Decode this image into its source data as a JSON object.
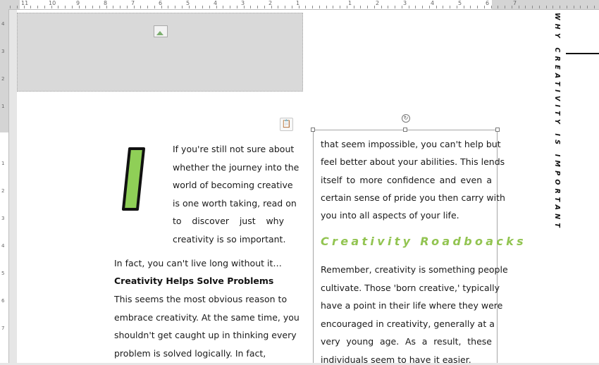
{
  "ruler_top": {
    "labels": [
      "11",
      "10",
      "9",
      "8",
      "7",
      "6",
      "5",
      "4",
      "3",
      "2",
      "1",
      "1",
      "2",
      "3",
      "4",
      "5",
      "6",
      "7"
    ]
  },
  "ruler_left": {
    "labels": [
      "4",
      "3",
      "2",
      "1",
      "1",
      "2",
      "3",
      "4",
      "5",
      "6",
      "7"
    ]
  },
  "colors": {
    "accent_green": "#92c451",
    "drop_cap_fill": "#8fcf57"
  },
  "document": {
    "drop_cap_letter": "I",
    "intro_lines": [
      "If you're still not sure about",
      "whether the journey into the",
      "world of becoming creative",
      "is one worth taking, read on",
      "to discover just why",
      "creativity is so important."
    ],
    "fact_line": "In fact, you can't live long without it…",
    "section_heading": "Creativity Helps Solve Problems",
    "section_lines": [
      "This seems the most obvious reason to",
      "embrace creativity. At the same time, you",
      "shouldn't get caught up in thinking every",
      "problem is solved logically. In fact,"
    ],
    "right_column_lines_1": [
      "that seem impossible, you can't help but",
      "feel better about your abilities. This lends",
      "itself to more confidence and even a",
      "certain sense of pride you then carry with",
      "you into all aspects of your life."
    ],
    "green_heading": "Creativity Roadboacks",
    "right_column_lines_2": [
      "Remember, creativity is something people",
      "cultivate. Those 'born creative,' typically",
      "have a point in their life where they were",
      "encouraged in creativity, generally at a",
      "very young age. As a result, these",
      "individuals seem to have it easier."
    ],
    "side_title": "WHY CREATIVITY IS IMPORTANT"
  },
  "icons": {
    "image_placeholder": "image-placeholder-icon",
    "paste_options": "paste-options-icon",
    "rotate_handle": "rotate-handle-icon"
  }
}
